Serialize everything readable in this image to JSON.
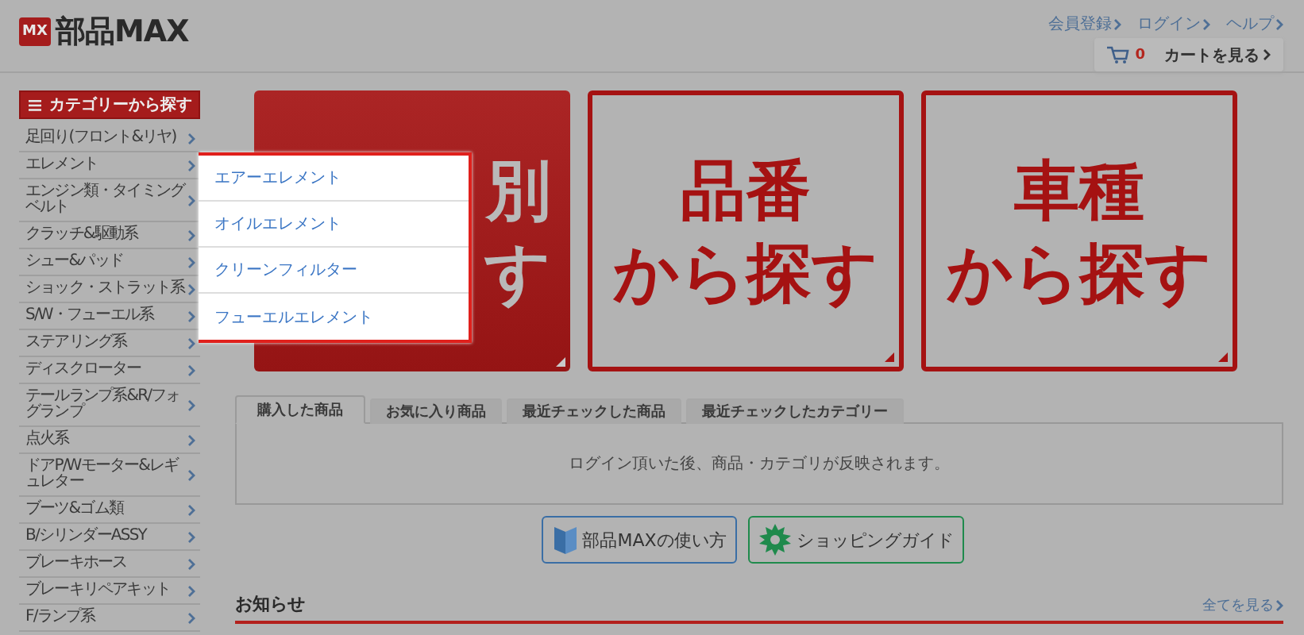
{
  "header": {
    "logo": {
      "badge": "MX",
      "name": "部品MAX"
    },
    "links": [
      "会員登録",
      "ログイン",
      "ヘルプ"
    ],
    "cart": {
      "count": "0",
      "label": "カートを見る"
    }
  },
  "sidebar": {
    "title": "カテゴリーから探す",
    "items": [
      {
        "label": "足回り(フロント&リヤ)"
      },
      {
        "label": "エレメント"
      },
      {
        "label": "エンジン類・タイミングベルト"
      },
      {
        "label": "クラッチ&駆動系"
      },
      {
        "label": "シュー&パッド"
      },
      {
        "label": "ショック・ストラット系"
      },
      {
        "label": "S/W・フューエル系"
      },
      {
        "label": "ステアリング系"
      },
      {
        "label": "ディスクローター"
      },
      {
        "label": "テールランプ系&R/フォグランプ"
      },
      {
        "label": "点火系"
      },
      {
        "label": "ドアP/Wモーター&レギュレター"
      },
      {
        "label": "ブーツ&ゴム類"
      },
      {
        "label": "B/シリンダーASSY"
      },
      {
        "label": "ブレーキホース"
      },
      {
        "label": "ブレーキリペアキット"
      },
      {
        "label": "F/ランプ系"
      }
    ]
  },
  "flyout": {
    "items": [
      "エアーエレメント",
      "オイルエレメント",
      "クリーンフィルター",
      "フューエルエレメント"
    ]
  },
  "search_tiles": [
    {
      "kind": "filled",
      "lines": [
        "別",
        "す"
      ]
    },
    {
      "kind": "outline",
      "lines": [
        "品番",
        "から探す"
      ]
    },
    {
      "kind": "outline",
      "lines": [
        "車種",
        "から探す"
      ]
    }
  ],
  "tabs": [
    {
      "label": "購入した商品",
      "selected": true
    },
    {
      "label": "お気に入り商品",
      "selected": false
    },
    {
      "label": "最近チェックした商品",
      "selected": false
    },
    {
      "label": "最近チェックしたカテゴリー",
      "selected": false
    }
  ],
  "tab_panel": {
    "message": "ログイン頂いた後、商品・カテゴリが反映されます。"
  },
  "guide_buttons": [
    {
      "kind": "book",
      "label": "部品MAXの使い方"
    },
    {
      "kind": "gear",
      "label": "ショッピングガイド"
    }
  ],
  "news": {
    "title": "お知らせ",
    "link": "全てを見る"
  }
}
